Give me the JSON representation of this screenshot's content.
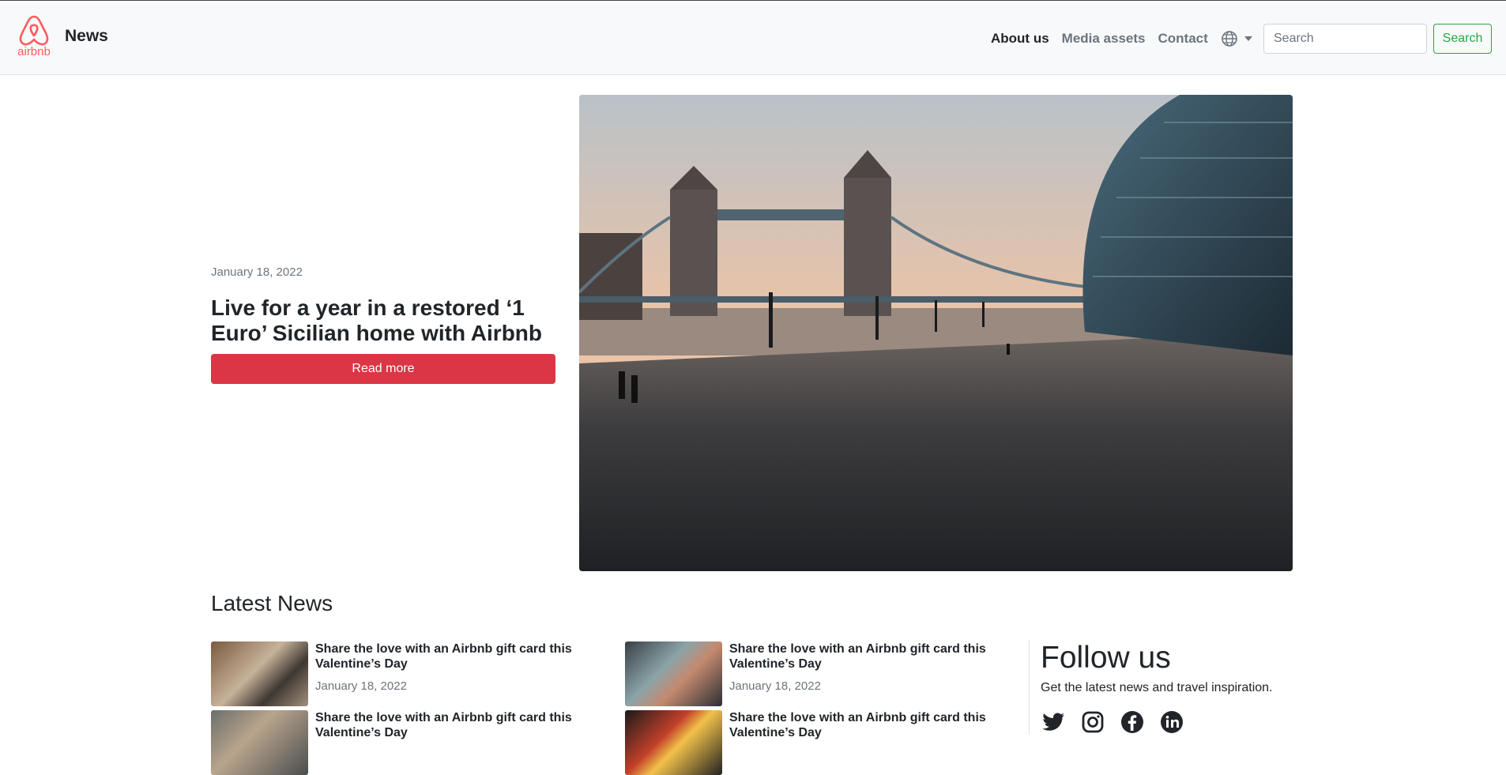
{
  "header": {
    "logo_text": "airbnb",
    "brand_name": "News",
    "nav": [
      {
        "label": "About us"
      },
      {
        "label": "Media assets"
      },
      {
        "label": "Contact"
      }
    ],
    "language_icon": "globe-icon",
    "search_placeholder": "Search",
    "search_button": "Search"
  },
  "hero": {
    "date": "January 18, 2022",
    "title": "Live for a year in a restored ‘1 Euro’ Sicilian home with Airbnb",
    "button": "Read more"
  },
  "latest": {
    "heading": "Latest News",
    "items": [
      {
        "title": "Share the love with an Airbnb gift card this Valentine’s Day",
        "date": "January 18, 2022"
      },
      {
        "title": "Share the love with an Airbnb gift card this Valentine’s Day",
        "date": "January 18, 2022"
      },
      {
        "title": "Share the love with an Airbnb gift card this Valentine’s Day",
        "date": ""
      },
      {
        "title": "Share the love with an Airbnb gift card this Valentine’s Day",
        "date": ""
      }
    ]
  },
  "follow": {
    "title": "Follow us",
    "subtitle": "Get the latest news and travel inspiration.",
    "icons": [
      "twitter-icon",
      "instagram-icon",
      "facebook-icon",
      "linkedin-icon"
    ]
  },
  "colors": {
    "brand": "#ff5a5f",
    "danger": "#dc3545",
    "success": "#28a745"
  }
}
